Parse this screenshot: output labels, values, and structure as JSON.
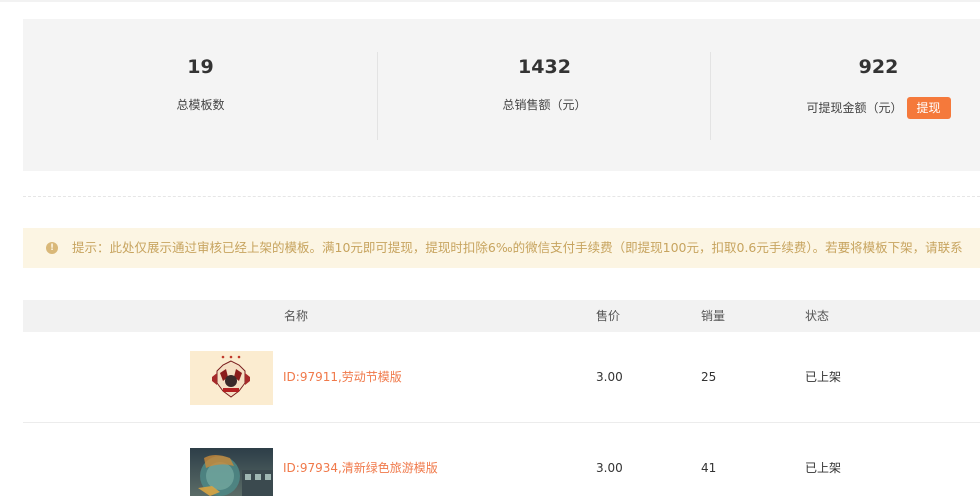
{
  "stats": {
    "total_templates": {
      "value": "19",
      "label": "总模板数"
    },
    "total_sales": {
      "value": "1432",
      "label": "总销售额（元）"
    },
    "withdrawable": {
      "value": "922",
      "label": "可提现金额（元）",
      "button": "提现"
    }
  },
  "notice": {
    "icon": "info-icon",
    "text": "提示：此处仅展示通过审核已经上架的模板。满10元即可提现，提现时扣除6‰的微信支付手续费（即提现100元，扣取0.6元手续费）。若要将模板下架，请联系"
  },
  "table": {
    "headers": {
      "name": "名称",
      "price": "售价",
      "sales": "销量",
      "status": "状态"
    },
    "rows": [
      {
        "name": "ID:97911,劳动节模版",
        "price": "3.00",
        "sales": "25",
        "status": "已上架"
      },
      {
        "name": "ID:97934,清新绿色旅游模版",
        "price": "3.00",
        "sales": "41",
        "status": "已上架"
      }
    ]
  },
  "colors": {
    "accent": "#f5793b",
    "link": "#f0794a",
    "notice_bg": "#fcf5e3",
    "notice_text": "#c7a45f",
    "panel_bg": "#f4f4f4"
  }
}
